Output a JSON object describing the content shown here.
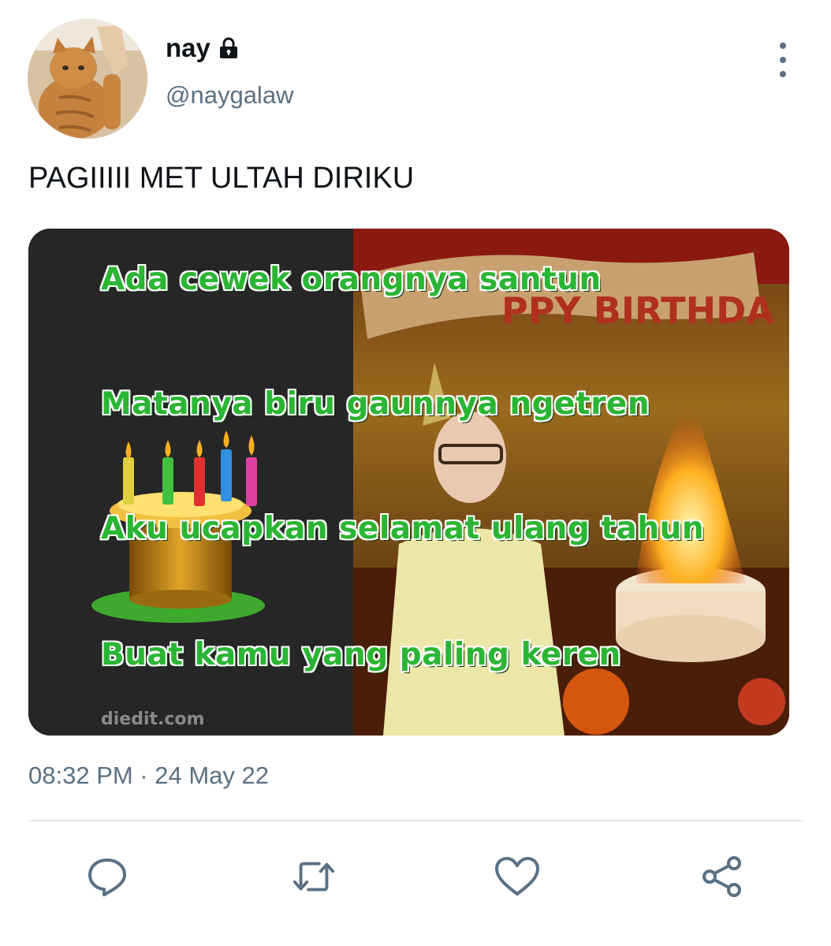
{
  "author": {
    "display_name": "nay",
    "handle": "@naygalaw",
    "locked_icon": "lock-icon"
  },
  "tweet": {
    "text": "PAGIIIII MET ULTAH DIRIKU",
    "timestamp": "08:32 PM · 24 May 22"
  },
  "media": {
    "lines": [
      "Ada cewek orangnya santun",
      "Matanya biru gaunnya ngetren",
      "Aku ucapkan selamat ulang tahun",
      "Buat kamu yang paling keren"
    ],
    "banner_text": "PPY BIRTHDA",
    "watermark": "diedit.com"
  },
  "actions": [
    "reply-icon",
    "retweet-icon",
    "like-icon",
    "share-icon"
  ],
  "colors": {
    "secondary_text": "#5b7083",
    "meme_green": "#2bb534",
    "divider": "#e1e8ed"
  }
}
